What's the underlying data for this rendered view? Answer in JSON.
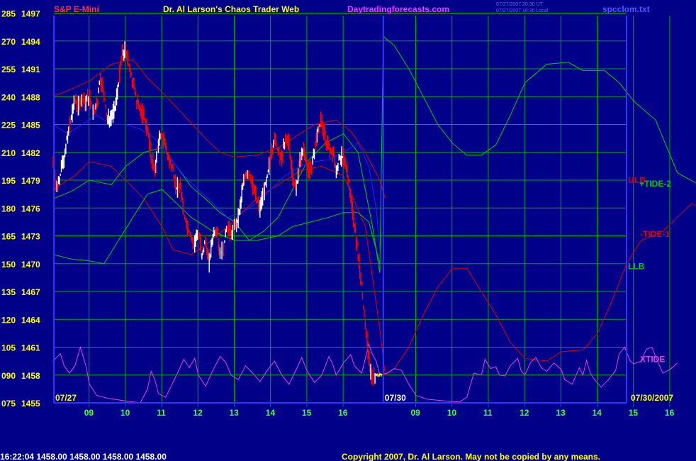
{
  "header": {
    "symbol": "S&P E-Mini",
    "title": "Dr. Al Larson's Chaos Trader Web",
    "site": "Daytradingforecasts.com",
    "stamp1": "07/27/2007 20:30 UT",
    "stamp2": "07/27/2007 16:30 Local",
    "file": "spcclom.txt"
  },
  "footer": {
    "status": "16:22:04  1458.00 1458.00 1458.00 1458.00",
    "copyright": "Copyright 2007, Dr. Al Larson. May not be copied by any means."
  },
  "colors": {
    "background": "#000088",
    "grid": "#00AA00",
    "axis": "#3333FF",
    "yellow": "#FFFF00",
    "white": "#FFFFFF",
    "price_up": "#FFFFFF",
    "price_down": "#FF0000",
    "red_line": "#DD0000",
    "green_line": "#00CC00",
    "blue_line": "#2222FF",
    "magenta": "#DD44DD",
    "tick_green": "#44FF44"
  },
  "chart_data": {
    "type": "line",
    "title": "S&P E-Mini",
    "left_axis_labels": [
      "285",
      "270",
      "255",
      "240",
      "225",
      "210",
      "195",
      "180",
      "165",
      "150",
      "135",
      "120",
      "105",
      "090",
      "075"
    ],
    "right_axis_labels": [
      "1497",
      "1494",
      "1491",
      "1488",
      "1485",
      "1482",
      "1479",
      "1476",
      "1473",
      "1470",
      "1467",
      "1464",
      "1461",
      "1458",
      "1455"
    ],
    "ylim": [
      1455,
      1497
    ],
    "x_tick_labels": [
      "09",
      "10",
      "11",
      "12",
      "13",
      "14",
      "15",
      "16",
      "09",
      "10",
      "11",
      "12",
      "13",
      "14",
      "15",
      "16"
    ],
    "date_labels": [
      "07/27",
      "07/30",
      "07/30/2007"
    ],
    "series_labels": [
      {
        "text": "ULB",
        "color": "#DD0000",
        "value": 1479.0
      },
      {
        "text": "+TIDE-2",
        "color": "#00CC00",
        "value": 1478.6
      },
      {
        "text": "-TIDE-1",
        "color": "#DD0000",
        "value": 1473.2
      },
      {
        "text": "LLB",
        "color": "#00CC00",
        "value": 1469.7
      },
      {
        "text": "XTIDE",
        "color": "#DD44DD",
        "value": 1459.7
      }
    ],
    "price_close": [
      [
        0.0,
        1481.0
      ],
      [
        0.1,
        1478.2
      ],
      [
        0.2,
        1479.5
      ],
      [
        0.3,
        1481.5
      ],
      [
        0.4,
        1484.0
      ],
      [
        0.5,
        1486.0
      ],
      [
        0.6,
        1487.5
      ],
      [
        0.7,
        1487.0
      ],
      [
        0.8,
        1488.0
      ],
      [
        0.9,
        1487.5
      ],
      [
        1.0,
        1488.0
      ],
      [
        1.1,
        1486.5
      ],
      [
        1.2,
        1487.0
      ],
      [
        1.3,
        1490.0
      ],
      [
        1.4,
        1488.5
      ],
      [
        1.5,
        1485.5
      ],
      [
        1.6,
        1486.0
      ],
      [
        1.7,
        1486.5
      ],
      [
        1.8,
        1489.5
      ],
      [
        1.9,
        1492.5
      ],
      [
        2.0,
        1493.0
      ],
      [
        2.1,
        1491.0
      ],
      [
        2.2,
        1489.5
      ],
      [
        2.3,
        1487.5
      ],
      [
        2.4,
        1486.5
      ],
      [
        2.5,
        1486.0
      ],
      [
        2.6,
        1484.5
      ],
      [
        2.7,
        1481.5
      ],
      [
        2.8,
        1480.0
      ],
      [
        2.9,
        1483.0
      ],
      [
        3.0,
        1484.0
      ],
      [
        3.1,
        1482.5
      ],
      [
        3.2,
        1481.0
      ],
      [
        3.3,
        1480.0
      ],
      [
        3.4,
        1478.0
      ],
      [
        3.5,
        1478.5
      ],
      [
        3.6,
        1475.5
      ],
      [
        3.7,
        1474.0
      ],
      [
        3.8,
        1473.0
      ],
      [
        3.9,
        1472.0
      ],
      [
        4.0,
        1473.5
      ],
      [
        4.1,
        1471.0
      ],
      [
        4.2,
        1472.5
      ],
      [
        4.3,
        1470.0
      ],
      [
        4.4,
        1473.0
      ],
      [
        4.5,
        1474.0
      ],
      [
        4.6,
        1471.0
      ],
      [
        4.7,
        1472.0
      ],
      [
        4.8,
        1474.0
      ],
      [
        4.9,
        1473.0
      ],
      [
        5.0,
        1474.0
      ],
      [
        5.1,
        1475.0
      ],
      [
        5.2,
        1477.5
      ],
      [
        5.3,
        1479.5
      ],
      [
        5.4,
        1480.0
      ],
      [
        5.5,
        1478.5
      ],
      [
        5.6,
        1477.0
      ],
      [
        5.7,
        1476.0
      ],
      [
        5.8,
        1477.5
      ],
      [
        5.9,
        1479.5
      ],
      [
        6.0,
        1481.5
      ],
      [
        6.1,
        1483.5
      ],
      [
        6.2,
        1482.0
      ],
      [
        6.3,
        1481.5
      ],
      [
        6.4,
        1483.5
      ],
      [
        6.5,
        1483.0
      ],
      [
        6.6,
        1479.5
      ],
      [
        6.7,
        1478.0
      ],
      [
        6.8,
        1481.0
      ],
      [
        6.9,
        1482.0
      ],
      [
        7.0,
        1480.5
      ],
      [
        7.1,
        1480.0
      ],
      [
        7.2,
        1482.0
      ],
      [
        7.3,
        1484.5
      ],
      [
        7.4,
        1485.5
      ],
      [
        7.5,
        1483.5
      ],
      [
        7.6,
        1482.5
      ],
      [
        7.7,
        1482.0
      ],
      [
        7.8,
        1480.0
      ],
      [
        7.9,
        1481.5
      ],
      [
        8.0,
        1481.5
      ],
      [
        8.1,
        1480.0
      ],
      [
        8.2,
        1477.5
      ],
      [
        8.3,
        1474.0
      ],
      [
        8.4,
        1471.0
      ],
      [
        8.5,
        1468.0
      ],
      [
        8.6,
        1463.0
      ],
      [
        8.7,
        1460.0
      ],
      [
        8.75,
        1458.0
      ],
      [
        8.9,
        1458.0
      ],
      [
        9.1,
        1458.0
      ]
    ],
    "red_upper": [
      [
        0,
        1488.0
      ],
      [
        0.6,
        1489.0
      ],
      [
        1.0,
        1489.7
      ],
      [
        1.6,
        1491.5
      ],
      [
        2.2,
        1492.0
      ],
      [
        2.6,
        1490.0
      ],
      [
        3.0,
        1488.5
      ],
      [
        3.6,
        1486.0
      ],
      [
        4.2,
        1483.5
      ],
      [
        4.6,
        1482.0
      ],
      [
        5.0,
        1481.5
      ],
      [
        5.6,
        1481.7
      ],
      [
        6.2,
        1482.5
      ],
      [
        6.8,
        1484.0
      ],
      [
        7.2,
        1485.0
      ],
      [
        7.8,
        1485.5
      ],
      [
        8.2,
        1484.3
      ],
      [
        8.6,
        1482.0
      ],
      [
        9.0,
        1479.0
      ],
      [
        9.15,
        1477.0
      ]
    ],
    "red_lower": [
      [
        0,
        1478.0
      ],
      [
        0.6,
        1479.5
      ],
      [
        1.0,
        1481.0
      ],
      [
        1.6,
        1480.5
      ],
      [
        2.0,
        1479.0
      ],
      [
        2.5,
        1477.0
      ],
      [
        3.0,
        1474.0
      ],
      [
        3.3,
        1471.5
      ],
      [
        3.8,
        1471.0
      ],
      [
        4.2,
        1472.0
      ],
      [
        4.8,
        1474.0
      ],
      [
        5.2,
        1475.5
      ],
      [
        5.6,
        1477.0
      ],
      [
        6.2,
        1478.5
      ],
      [
        6.8,
        1480.0
      ],
      [
        7.4,
        1480.5
      ],
      [
        8.0,
        1479.5
      ],
      [
        8.6,
        1474.0
      ],
      [
        9.0,
        1463.0
      ],
      [
        9.15,
        1458.0
      ],
      [
        9.4,
        1458.7
      ],
      [
        9.8,
        1461.0
      ],
      [
        10.2,
        1464.5
      ],
      [
        10.6,
        1467.5
      ],
      [
        11.0,
        1469.5
      ],
      [
        11.4,
        1469.5
      ],
      [
        11.8,
        1467.0
      ],
      [
        12.2,
        1464.5
      ],
      [
        12.6,
        1461.5
      ],
      [
        13.0,
        1459.8
      ],
      [
        13.6,
        1459.5
      ],
      [
        14.0,
        1460.5
      ],
      [
        14.6,
        1460.7
      ],
      [
        15.0,
        1462.5
      ],
      [
        15.4,
        1466.0
      ],
      [
        15.8,
        1470.0
      ],
      [
        16.2,
        1472.5
      ],
      [
        16.8,
        1473.5
      ],
      [
        17.2,
        1475.0
      ],
      [
        17.6,
        1476.5
      ],
      [
        18.0,
        1475.7
      ],
      [
        18.1,
        1473.5
      ]
    ],
    "green_upper": [
      [
        0,
        1477.0
      ],
      [
        0.5,
        1477.8
      ],
      [
        1.0,
        1479.0
      ],
      [
        1.6,
        1478.5
      ],
      [
        2.0,
        1480.5
      ],
      [
        2.5,
        1482.0
      ],
      [
        3.0,
        1482.5
      ],
      [
        3.4,
        1480.5
      ],
      [
        3.8,
        1478.3
      ],
      [
        4.2,
        1477.0
      ],
      [
        4.6,
        1475.5
      ],
      [
        5.0,
        1474.5
      ],
      [
        5.4,
        1472.5
      ],
      [
        5.8,
        1473.5
      ],
      [
        6.2,
        1475.0
      ],
      [
        6.6,
        1478.0
      ],
      [
        7.0,
        1481.0
      ],
      [
        7.5,
        1483.0
      ],
      [
        8.0,
        1484.0
      ],
      [
        8.4,
        1482.0
      ],
      [
        8.6,
        1478.0
      ],
      [
        8.8,
        1474.0
      ],
      [
        9.0,
        1469.0
      ],
      [
        9.1,
        1494.5
      ],
      [
        9.4,
        1493.5
      ],
      [
        9.8,
        1491.0
      ],
      [
        10.2,
        1488.0
      ],
      [
        10.6,
        1485.0
      ],
      [
        11.0,
        1483.0
      ],
      [
        11.4,
        1481.7
      ],
      [
        11.8,
        1481.7
      ],
      [
        12.2,
        1482.8
      ],
      [
        12.6,
        1486.0
      ],
      [
        13.0,
        1489.5
      ],
      [
        13.6,
        1491.5
      ],
      [
        14.2,
        1491.7
      ],
      [
        14.6,
        1490.8
      ],
      [
        15.2,
        1490.8
      ],
      [
        15.6,
        1489.5
      ],
      [
        16.0,
        1487.5
      ],
      [
        16.6,
        1485.5
      ],
      [
        17.2,
        1479.8
      ],
      [
        17.8,
        1478.5
      ],
      [
        18.2,
        1476.5
      ],
      [
        18.45,
        1478.6
      ]
    ],
    "green_lower": [
      [
        0,
        1471.0
      ],
      [
        0.5,
        1470.5
      ],
      [
        1.0,
        1470.3
      ],
      [
        1.4,
        1470.0
      ],
      [
        1.8,
        1472.5
      ],
      [
        2.2,
        1475.0
      ],
      [
        2.6,
        1477.5
      ],
      [
        3.0,
        1478.0
      ],
      [
        3.4,
        1476.5
      ],
      [
        3.8,
        1475.0
      ],
      [
        4.4,
        1473.5
      ],
      [
        5.0,
        1472.5
      ],
      [
        5.6,
        1472.5
      ],
      [
        6.2,
        1473.0
      ],
      [
        6.6,
        1474.0
      ],
      [
        7.2,
        1474.6
      ],
      [
        7.6,
        1475.0
      ],
      [
        8.0,
        1475.5
      ],
      [
        8.4,
        1475.5
      ],
      [
        8.7,
        1474.5
      ],
      [
        9.0,
        1470.0
      ]
    ],
    "blue_line": [
      [
        0,
        1485.0
      ],
      [
        0.4,
        1484.0
      ],
      [
        0.8,
        1485.0
      ],
      [
        1.2,
        1486.0
      ],
      [
        1.6,
        1485.0
      ],
      [
        2.0,
        1485.0
      ],
      [
        2.4,
        1484.5
      ],
      [
        2.8,
        1483.5
      ],
      [
        3.2,
        1481.5
      ],
      [
        3.6,
        1479.5
      ],
      [
        4.0,
        1478.0
      ],
      [
        4.4,
        1476.5
      ],
      [
        4.8,
        1475.0
      ],
      [
        5.2,
        1475.5
      ],
      [
        5.6,
        1476.5
      ],
      [
        6.0,
        1478.0
      ],
      [
        6.4,
        1479.5
      ],
      [
        6.8,
        1480.5
      ],
      [
        7.2,
        1481.0
      ],
      [
        7.6,
        1481.2
      ],
      [
        8.0,
        1482.0
      ],
      [
        8.4,
        1483.0
      ],
      [
        8.7,
        1480.5
      ],
      [
        8.9,
        1476.0
      ],
      [
        9.0,
        1471.5
      ]
    ],
    "xtide": [
      [
        0,
        1459.5
      ],
      [
        0.2,
        1460.3
      ],
      [
        0.3,
        1459.0
      ],
      [
        0.45,
        1458.2
      ],
      [
        0.6,
        1459.0
      ],
      [
        0.75,
        1461.0
      ],
      [
        0.9,
        1459.0
      ],
      [
        1.0,
        1457.0
      ],
      [
        1.2,
        1455.8
      ],
      [
        1.5,
        1455.5
      ],
      [
        2.0,
        1455.2
      ],
      [
        2.4,
        1455.0
      ],
      [
        2.6,
        1456.5
      ],
      [
        2.7,
        1458.4
      ],
      [
        2.8,
        1457.5
      ],
      [
        2.9,
        1456.0
      ],
      [
        3.1,
        1455.6
      ],
      [
        3.4,
        1458.0
      ],
      [
        3.6,
        1459.7
      ],
      [
        3.75,
        1458.8
      ],
      [
        3.9,
        1459.8
      ],
      [
        4.0,
        1458.0
      ],
      [
        4.2,
        1456.8
      ],
      [
        4.4,
        1458.5
      ],
      [
        4.6,
        1460.0
      ],
      [
        4.75,
        1459.4
      ],
      [
        4.9,
        1458.0
      ],
      [
        5.1,
        1457.5
      ],
      [
        5.3,
        1459.0
      ],
      [
        5.5,
        1458.2
      ],
      [
        5.7,
        1457.3
      ],
      [
        5.9,
        1458.5
      ],
      [
        6.1,
        1459.5
      ],
      [
        6.3,
        1458.0
      ],
      [
        6.5,
        1457.0
      ],
      [
        6.7,
        1458.6
      ],
      [
        6.85,
        1459.9
      ],
      [
        7.0,
        1458.4
      ],
      [
        7.2,
        1457.2
      ],
      [
        7.4,
        1458.0
      ],
      [
        7.6,
        1460.0
      ],
      [
        7.7,
        1459.2
      ],
      [
        7.8,
        1458.0
      ],
      [
        8.0,
        1459.3
      ],
      [
        8.2,
        1460.2
      ],
      [
        8.3,
        1459.0
      ],
      [
        8.5,
        1458.2
      ],
      [
        8.7,
        1461.3
      ],
      [
        8.8,
        1460.2
      ],
      [
        8.9,
        1459.5
      ],
      [
        9.0,
        1458.0
      ],
      [
        9.2,
        1458.2
      ],
      [
        9.4,
        1458.7
      ],
      [
        9.6,
        1458.5
      ],
      [
        9.8,
        1457.0
      ],
      [
        10.0,
        1455.8
      ],
      [
        10.3,
        1455.4
      ],
      [
        10.8,
        1455.2
      ],
      [
        11.2,
        1455.1
      ],
      [
        11.4,
        1455.6
      ],
      [
        11.5,
        1457.0
      ],
      [
        11.6,
        1458.2
      ],
      [
        11.8,
        1458.0
      ],
      [
        11.9,
        1459.7
      ],
      [
        12.05,
        1458.7
      ],
      [
        12.2,
        1458.9
      ],
      [
        12.3,
        1458.0
      ],
      [
        12.45,
        1457.9
      ],
      [
        12.6,
        1459.0
      ],
      [
        12.8,
        1459.8
      ],
      [
        12.9,
        1458.4
      ],
      [
        13.0,
        1458.0
      ],
      [
        13.15,
        1459.3
      ],
      [
        13.3,
        1459.9
      ],
      [
        13.45,
        1458.8
      ],
      [
        13.6,
        1458.4
      ],
      [
        13.8,
        1459.3
      ],
      [
        14.0,
        1458.6
      ],
      [
        14.1,
        1457.5
      ],
      [
        14.3,
        1457.0
      ],
      [
        14.5,
        1458.8
      ],
      [
        14.6,
        1458.0
      ],
      [
        14.7,
        1459.6
      ],
      [
        14.8,
        1458.2
      ],
      [
        14.9,
        1457.6
      ],
      [
        15.1,
        1456.7
      ],
      [
        15.3,
        1457.5
      ],
      [
        15.5,
        1458.5
      ],
      [
        15.6,
        1460.3
      ],
      [
        15.75,
        1461.0
      ],
      [
        15.9,
        1459.5
      ],
      [
        16.0,
        1459.2
      ],
      [
        16.2,
        1459.5
      ],
      [
        16.35,
        1460.8
      ],
      [
        16.5,
        1461.0
      ],
      [
        16.65,
        1459.5
      ],
      [
        16.8,
        1458.2
      ],
      [
        17.0,
        1458.6
      ],
      [
        17.2,
        1459.3
      ]
    ]
  }
}
